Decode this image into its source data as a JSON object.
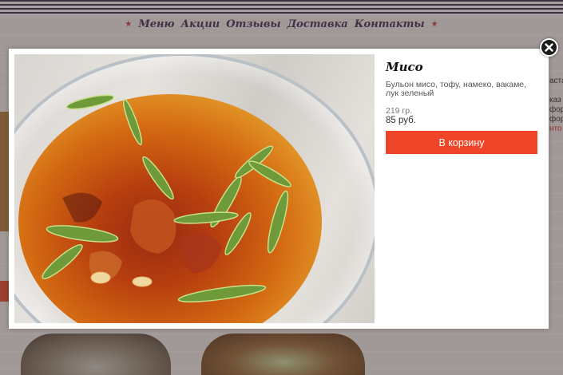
{
  "nav": {
    "items": [
      "Меню",
      "Акции",
      "Отзывы",
      "Доставка",
      "Контакты"
    ]
  },
  "background": {
    "right_text_lines": [
      "аста",
      "",
      "каз",
      "форм",
      "фор",
      "нто"
    ]
  },
  "modal": {
    "title": "Мисо",
    "description": "Бульон мисо, тофу, намеко, вакаме, лук зеленый",
    "weight": "219 гр.",
    "price": "85 руб.",
    "cart_button": "В корзину",
    "close_icon": "close-icon"
  },
  "colors": {
    "accent": "#ee4528",
    "nav_text": "#4a2f52",
    "nav_star": "#c94040"
  }
}
